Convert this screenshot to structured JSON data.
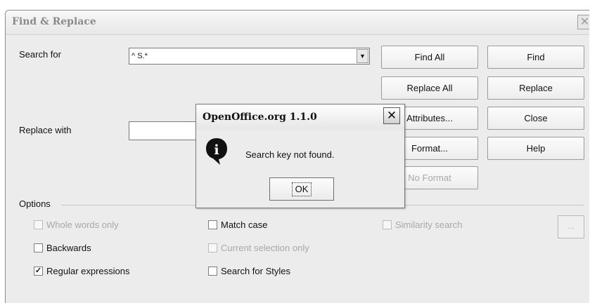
{
  "window": {
    "title": "Find & Replace"
  },
  "search": {
    "label": "Search for",
    "value": "^ S.*"
  },
  "replace": {
    "label": "Replace with",
    "value": ""
  },
  "buttons": {
    "find_all": "Find All",
    "find": "Find",
    "replace_all": "Replace All",
    "replace": "Replace",
    "attributes": "Attributes...",
    "close": "Close",
    "format": "Format...",
    "help": "Help",
    "no_format": "No Format",
    "similarity_settings": "..."
  },
  "options": {
    "label": "Options",
    "whole_words": {
      "label": "Whole words only",
      "checked": false,
      "enabled": false
    },
    "match_case": {
      "label": "Match case",
      "checked": false,
      "enabled": true
    },
    "similarity": {
      "label": "Similarity search",
      "checked": false,
      "enabled": false
    },
    "backwards": {
      "label": "Backwards",
      "checked": false,
      "enabled": true
    },
    "current_selection": {
      "label": "Current selection only",
      "checked": false,
      "enabled": false
    },
    "regex": {
      "label": "Regular expressions",
      "checked": true,
      "enabled": true
    },
    "styles": {
      "label": "Search for Styles",
      "checked": false,
      "enabled": true
    }
  },
  "message": {
    "title": "OpenOffice.org 1.1.0",
    "text": "Search key not found.",
    "ok_label": "OK",
    "icon": "info-icon"
  },
  "glyphs": {
    "close": "✕",
    "dropdown": "▼",
    "check": "✓",
    "info": "i"
  }
}
